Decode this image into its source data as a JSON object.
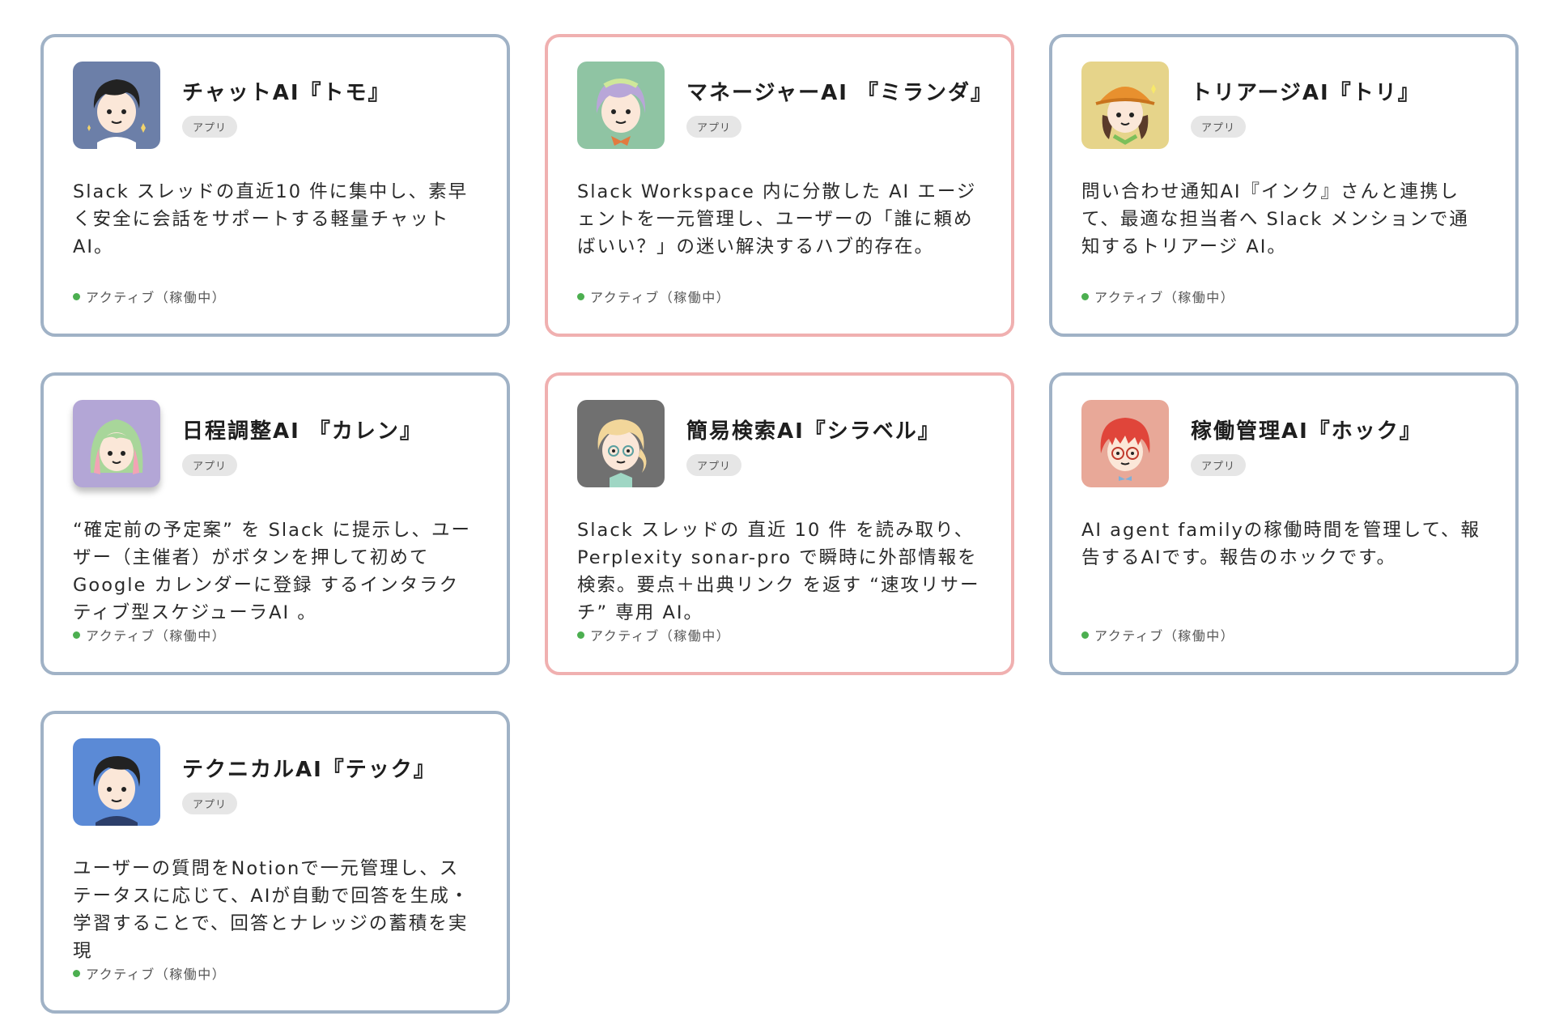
{
  "cards": [
    {
      "title": "チャットAI『トモ』",
      "badge": "アプリ",
      "description": "Slack スレッドの直近10 件に集中し、素早く安全に会話をサポートする軽量チャット AI。",
      "status": "アクティブ（稼働中）",
      "avatar_bg": "#6c7fa8",
      "border": "#a0b2c6"
    },
    {
      "title": "マネージャーAI 『ミランダ』",
      "badge": "アプリ",
      "description": "Slack Workspace 内に分散した AI エージェントを一元管理し、ユーザーの「誰に頼めばいい？」の迷い解決するハブ的存在。",
      "status": "アクティブ（稼働中）",
      "avatar_bg": "#8fc4a3",
      "border": "#f0b0b0"
    },
    {
      "title": "トリアージAI『トリ』",
      "badge": "アプリ",
      "description": "問い合わせ通知AI『インク』さんと連携して、最適な担当者へ Slack メンションで通知するトリアージ AI。",
      "status": "アクティブ（稼働中）",
      "avatar_bg": "#e6d48a",
      "border": "#a0b2c6"
    },
    {
      "title": "日程調整AI 『カレン』",
      "badge": "アプリ",
      "description": "“確定前の予定案” を Slack に提示し、ユーザー（主催者）がボタンを押して初めて Google カレンダーに登録 するインタラクティブ型スケジューラAI 。",
      "status": "アクティブ（稼働中）",
      "avatar_bg": "#b3a6d6",
      "border": "#a0b2c6"
    },
    {
      "title": "簡易検索AI『シラベル』",
      "badge": "アプリ",
      "description": "Slack スレッドの 直近 10 件 を読み取り、Perplexity sonar-pro で瞬時に外部情報を検索。要点＋出典リンク を返す “速攻リサーチ” 専用 AI。",
      "status": "アクティブ（稼働中）",
      "avatar_bg": "#707070",
      "border": "#f0b0b0"
    },
    {
      "title": "稼働管理AI『ホック』",
      "badge": "アプリ",
      "description": "AI agent familyの稼働時間を管理して、報告するAIです。報告のホックです。",
      "status": "アクティブ（稼働中）",
      "avatar_bg": "#e8a898",
      "border": "#a0b2c6"
    },
    {
      "title": "テクニカルAI『テック』",
      "badge": "アプリ",
      "description": "ユーザーの質問をNotionで一元管理し、ステータスに応じて、AIが自動で回答を生成・学習することで、回答とナレッジの蓄積を実現",
      "status": "アクティブ（稼働中）",
      "avatar_bg": "#5b8ad6",
      "border": "#a0b2c6"
    }
  ],
  "colors": {
    "status_dot": "#4caf50",
    "badge_bg": "#e6e6e6"
  }
}
